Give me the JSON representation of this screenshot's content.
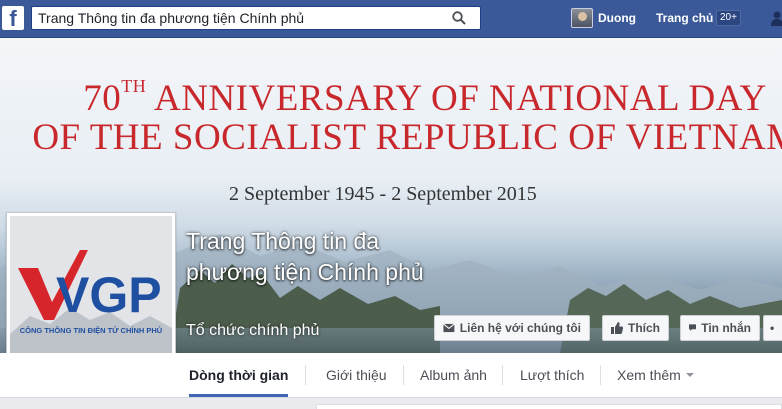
{
  "topbar": {
    "logo": "f",
    "search_value": "Trang Thông tin đa phương tiện Chính phủ",
    "search_icon": "search-icon",
    "user_name": "Duong",
    "home_label": "Trang chủ",
    "home_count": "20+",
    "bar_color": "#3b5998"
  },
  "cover": {
    "line1_number": "70",
    "line1_suffix": "TH",
    "line1_rest": " ANNIVERSARY OF NATIONAL DAY",
    "line2": "OF THE SOCIALIST REPUBLIC OF VIETNAM",
    "dates": "2 September 1945 - 2 September 2015",
    "title_color": "#c8282c"
  },
  "page": {
    "title": "Trang Thông tin đa phương tiện Chính phủ",
    "category": "Tổ chức chính phủ"
  },
  "profile_logo": {
    "letters": "VGP",
    "caption": "CÔNG THÔNG TIN ĐIỆN TỬ CHÍNH PHỦ",
    "red": "#d7262b",
    "blue": "#1f4fa0"
  },
  "actions": {
    "contact": "Liên hệ với chúng tôi",
    "like": "Thích",
    "message": "Tin nhắn",
    "more": "•"
  },
  "tabs": {
    "timeline": "Dòng thời gian",
    "about": "Giới thiệu",
    "photos": "Album ảnh",
    "likes": "Lượt thích",
    "more": "Xem thêm"
  }
}
